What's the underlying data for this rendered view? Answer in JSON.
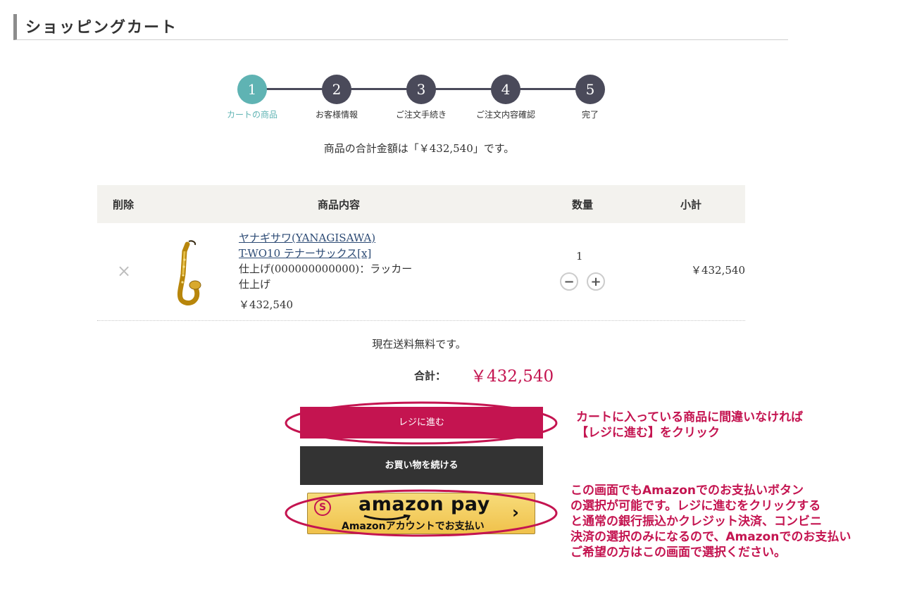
{
  "page_title": "ショッピングカート",
  "steps": [
    {
      "num": "1",
      "label": "カートの商品"
    },
    {
      "num": "2",
      "label": "お客様情報"
    },
    {
      "num": "3",
      "label": "ご注文手続き"
    },
    {
      "num": "4",
      "label": "ご注文内容確認"
    },
    {
      "num": "5",
      "label": "完了"
    }
  ],
  "total_message": "商品の合計金額は「￥432,540」です。",
  "table": {
    "headers": {
      "delete": "削除",
      "content": "商品内容",
      "qty": "数量",
      "subtotal": "小計"
    },
    "item": {
      "delete_icon": "×",
      "name_line1": "ヤナギサワ(YANAGISAWA)",
      "name_line2": "T-WO10 テナーサックス[x]",
      "option": "仕上げ(000000000000)：ラッカー仕上げ",
      "price": "￥432,540",
      "quantity": "1",
      "minus": "−",
      "plus": "+",
      "subtotal": "￥432,540"
    }
  },
  "shipping_message": "現在送料無料です。",
  "grand_total": {
    "label": "合計：",
    "value": "￥432,540"
  },
  "buttons": {
    "checkout": "レジに進む",
    "continue": "お買い物を続ける"
  },
  "amazon_pay": {
    "logo": "amazon pay",
    "sub": "Amazonアカウントでお支払い",
    "chevron": "›",
    "badge": "S"
  },
  "annotations": {
    "note1": "カートに入っている商品に間違いなければ\n【レジに進む】をクリック",
    "note2": "この画面でもAmazonでのお支払いボタン\nの選択が可能です。レジに進むをクリックする\nと通常の銀行振込かクレジット決済、コンビニ\n決済の選択のみになるので、Amazonでのお支払い\nご希望の方はこの画面で選択ください。"
  },
  "colors": {
    "accent": "#c41450",
    "step_active": "#5fb3b3",
    "step_inactive": "#4a4a5a",
    "amazon": "#f0c14b"
  }
}
